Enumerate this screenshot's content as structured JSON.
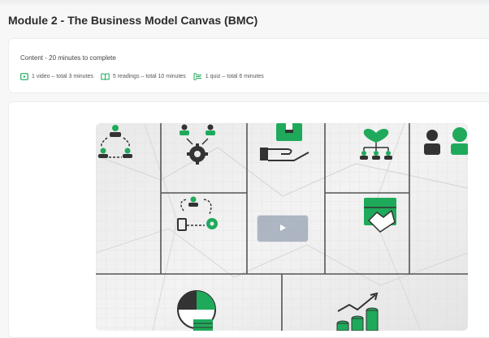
{
  "module": {
    "title": "Module 2 - The Business Model Canvas (BMC)"
  },
  "content": {
    "summary": "Content - 20 minutes to complete",
    "items": [
      {
        "icon": "video-icon",
        "label": "1 video – total 3 minutes"
      },
      {
        "icon": "book-icon",
        "label": "5 readings – total 10 minutes"
      },
      {
        "icon": "quiz-icon",
        "label": "1 quiz – total 6 minutes"
      }
    ]
  },
  "colors": {
    "accent_green": "#1faa5b",
    "icon_dark": "#333333"
  },
  "video": {
    "thumbnail_icons": [
      "key-partners-network-icon",
      "key-activities-gear-icon",
      "value-proposition-box-hand-icon",
      "customer-relationships-heart-icon",
      "customer-segments-people-icon",
      "key-resources-cycle-icon",
      "channels-delivery-box-icon",
      "cost-structure-pie-icon",
      "revenue-streams-growth-icon"
    ]
  }
}
